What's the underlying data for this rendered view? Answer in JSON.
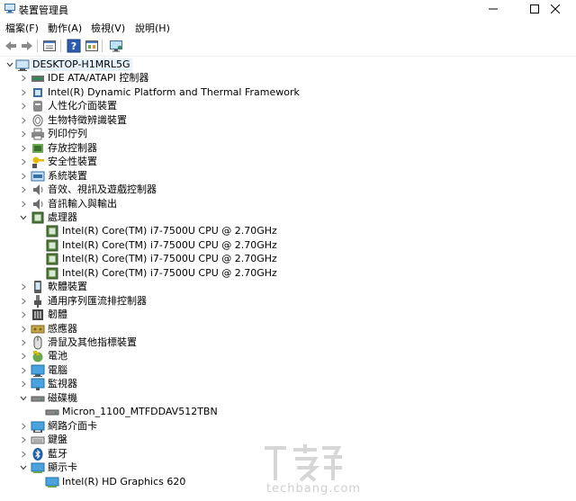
{
  "window": {
    "title": "裝置管理員"
  },
  "menu": [
    "檔案(F)",
    "動作(A)",
    "檢視(V)",
    "說明(H)"
  ],
  "toolbar": {
    "icons": [
      "back-arrow-icon",
      "forward-arrow-icon",
      "properties-icon",
      "help-icon",
      "scan-hardware-icon",
      "computer-monitor-icon"
    ]
  },
  "tree": {
    "root": "DESKTOP-H1MRL5G",
    "categories": [
      {
        "label": "IDE ATA/ATAPI 控制器",
        "icon": "ide-controller-icon",
        "expanded": false,
        "children": []
      },
      {
        "label": "Intel(R) Dynamic Platform and Thermal Framework",
        "icon": "chip-icon",
        "expanded": false,
        "children": []
      },
      {
        "label": "人性化介面裝置",
        "icon": "hid-icon",
        "expanded": false,
        "children": []
      },
      {
        "label": "生物特徵辨識裝置",
        "icon": "fingerprint-icon",
        "expanded": false,
        "children": []
      },
      {
        "label": "列印佇列",
        "icon": "printer-icon",
        "expanded": false,
        "children": []
      },
      {
        "label": "存放控制器",
        "icon": "storage-controller-icon",
        "expanded": false,
        "children": []
      },
      {
        "label": "安全性裝置",
        "icon": "security-key-icon",
        "expanded": false,
        "children": []
      },
      {
        "label": "系統裝置",
        "icon": "system-device-icon",
        "expanded": false,
        "children": []
      },
      {
        "label": "音效、視訊及遊戲控制器",
        "icon": "speaker-icon",
        "expanded": false,
        "children": []
      },
      {
        "label": "音訊輸入與輸出",
        "icon": "speaker-icon",
        "expanded": false,
        "children": []
      },
      {
        "label": "處理器",
        "icon": "processor-icon",
        "expanded": true,
        "children": [
          "Intel(R) Core(TM) i7-7500U CPU @ 2.70GHz",
          "Intel(R) Core(TM) i7-7500U CPU @ 2.70GHz",
          "Intel(R) Core(TM) i7-7500U CPU @ 2.70GHz",
          "Intel(R) Core(TM) i7-7500U CPU @ 2.70GHz"
        ]
      },
      {
        "label": "軟體裝置",
        "icon": "software-device-icon",
        "expanded": false,
        "children": []
      },
      {
        "label": "通用序列匯流排控制器",
        "icon": "usb-icon",
        "expanded": false,
        "children": []
      },
      {
        "label": "韌體",
        "icon": "firmware-icon",
        "expanded": false,
        "children": []
      },
      {
        "label": "感應器",
        "icon": "sensor-icon",
        "expanded": false,
        "children": []
      },
      {
        "label": "滑鼠及其他指標裝置",
        "icon": "mouse-icon",
        "expanded": false,
        "children": []
      },
      {
        "label": "電池",
        "icon": "battery-icon",
        "expanded": false,
        "children": []
      },
      {
        "label": "電腦",
        "icon": "computer-icon",
        "expanded": false,
        "children": []
      },
      {
        "label": "監視器",
        "icon": "monitor-icon",
        "expanded": false,
        "children": []
      },
      {
        "label": "磁碟機",
        "icon": "disk-drive-icon",
        "expanded": true,
        "children": [
          "Micron_1100_MTFDDAV512TBN"
        ]
      },
      {
        "label": "網路介面卡",
        "icon": "network-adapter-icon",
        "expanded": false,
        "children": []
      },
      {
        "label": "鍵盤",
        "icon": "keyboard-icon",
        "expanded": false,
        "children": []
      },
      {
        "label": "藍牙",
        "icon": "bluetooth-icon",
        "expanded": false,
        "children": []
      },
      {
        "label": "顯示卡",
        "icon": "display-adapter-icon",
        "expanded": true,
        "children": [
          "Intel(R) HD Graphics 620"
        ]
      }
    ]
  },
  "watermark": {
    "logo": "T客邦",
    "text": "techbang.com"
  }
}
